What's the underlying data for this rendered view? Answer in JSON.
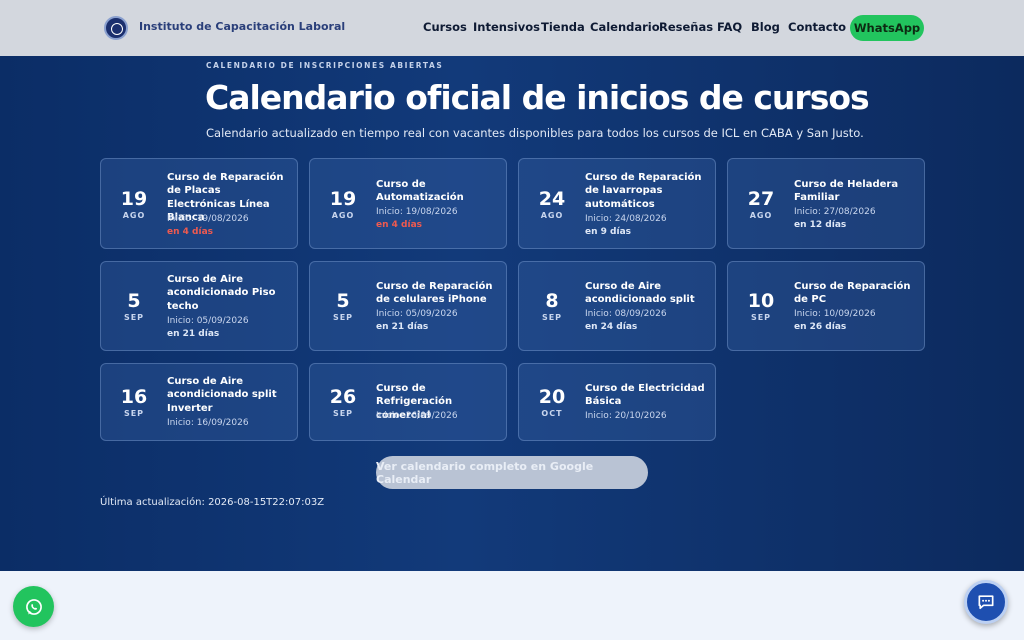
{
  "header": {
    "brand": "Instituto de Capacitación Laboral",
    "nav": [
      "Cursos",
      "Intensivos",
      "Tienda",
      "Calendario",
      "Reseñas",
      "FAQ",
      "Blog",
      "Contacto"
    ],
    "cta": "WhatsApp"
  },
  "hero": {
    "eyebrow": "CALENDARIO DE INSCRIPCIONES ABIERTAS",
    "title": "Calendario oficial de inicios de cursos",
    "subtitle": "Calendario actualizado en tiempo real con vacantes disponibles para todos los cursos de ICL en CABA y San Justo."
  },
  "courses": [
    {
      "day": "19",
      "month": "AGO",
      "name": "Curso de Reparación de Placas Electrónicas Línea Blanca",
      "start": "Inicio: 19/08/2026",
      "days_left": "en 4 días",
      "urgent": true
    },
    {
      "day": "19",
      "month": "AGO",
      "name": "Curso de Automatización",
      "start": "Inicio: 19/08/2026",
      "days_left": "en 4 días",
      "urgent": true
    },
    {
      "day": "24",
      "month": "AGO",
      "name": "Curso de Reparación de lavarropas automáticos",
      "start": "Inicio: 24/08/2026",
      "days_left": "en 9 días",
      "urgent": false
    },
    {
      "day": "27",
      "month": "AGO",
      "name": "Curso de Heladera Familiar",
      "start": "Inicio: 27/08/2026",
      "days_left": "en 12 días",
      "urgent": false
    },
    {
      "day": "5",
      "month": "SEP",
      "name": "Curso de Aire acondicionado Piso techo",
      "start": "Inicio: 05/09/2026",
      "days_left": "en 21 días",
      "urgent": false
    },
    {
      "day": "5",
      "month": "SEP",
      "name": "Curso de Reparación de celulares iPhone",
      "start": "Inicio: 05/09/2026",
      "days_left": "en 21 días",
      "urgent": false
    },
    {
      "day": "8",
      "month": "SEP",
      "name": "Curso de Aire acondicionado split",
      "start": "Inicio: 08/09/2026",
      "days_left": "en 24 días",
      "urgent": false
    },
    {
      "day": "10",
      "month": "SEP",
      "name": "Curso de Reparación de PC",
      "start": "Inicio: 10/09/2026",
      "days_left": "en 26 días",
      "urgent": false
    },
    {
      "day": "16",
      "month": "SEP",
      "name": "Curso de Aire acondicionado split Inverter",
      "start": "Inicio: 16/09/2026",
      "days_left": "",
      "urgent": false
    },
    {
      "day": "26",
      "month": "SEP",
      "name": "Curso de Refrigeración comercial",
      "start": "Inicio: 26/09/2026",
      "days_left": "",
      "urgent": false
    },
    {
      "day": "20",
      "month": "OCT",
      "name": "Curso de Electricidad Básica",
      "start": "Inicio: 20/10/2026",
      "days_left": "",
      "urgent": false
    }
  ],
  "gcal_button": "Ver calendario completo en Google Calendar",
  "updated": "Última actualización: 2026-08-15T22:07:03Z",
  "icons": {
    "logo": "institute-logo-icon",
    "whatsapp_fab": "whatsapp-icon",
    "chat_fab": "chat-icon"
  },
  "colors": {
    "accent_green": "#22c45e",
    "urgent_red": "#ef5a4f",
    "hero_blue": "#0b2d66"
  }
}
